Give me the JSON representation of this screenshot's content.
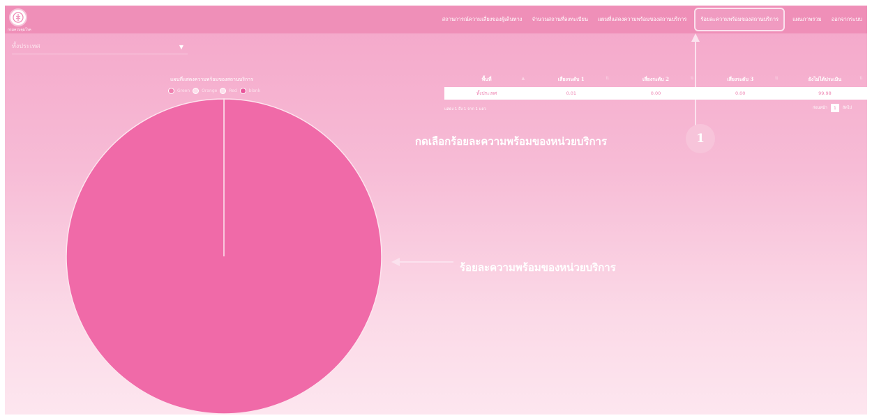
{
  "app": {
    "logo_caption": "กรมควบคุมโรค"
  },
  "nav": {
    "items": [
      {
        "label": "สถานการณ์ความเสี่ยงของผู้เดินทาง"
      },
      {
        "label": "จำนวนสถานที่ลงทะเบียน"
      },
      {
        "label": "แผนที่แสดงความพร้อมของสถานบริการ"
      },
      {
        "label": "ร้อยละความพร้อมของสถานบริการ"
      },
      {
        "label": "แผนภาพรวม"
      },
      {
        "label": "ออกจากระบบ"
      }
    ],
    "active_index": 3
  },
  "filter": {
    "selected": "ทั้งประเทศ"
  },
  "chart_data": {
    "type": "pie",
    "title": "แผนที่แสดงความพร้อมของสถานบริการ",
    "legend": [
      {
        "name": "Green",
        "color": "#f080b0",
        "hollow": false
      },
      {
        "name": "Orange",
        "color": "#fce0ec",
        "hollow": true
      },
      {
        "name": "Red",
        "color": "#fce0ec",
        "hollow": true
      },
      {
        "name": "blank",
        "color": "#e8559a",
        "hollow": false
      }
    ],
    "slices": [
      {
        "name": "Green",
        "value": 0.01
      },
      {
        "name": "Orange",
        "value": 0.0
      },
      {
        "name": "Red",
        "value": 0.0
      },
      {
        "name": "blank",
        "value": 99.98
      }
    ],
    "fill_color": "#f06aa8"
  },
  "table": {
    "headers": [
      "พื้นที่",
      "เสี่ยงระดับ 1",
      "เสี่ยงระดับ 2",
      "เสี่ยงระดับ 3",
      "ยังไม่ได้ประเมิน"
    ],
    "rows": [
      [
        "ทั้งประเทศ",
        "0.01",
        "0.00",
        "0.00",
        "99.98"
      ]
    ],
    "info": "แสดง 1 ถึง 1 จาก 1 แถว",
    "pager": {
      "prev": "ก่อนหน้า",
      "page": "1",
      "next": "ถัดไป"
    }
  },
  "annotations": {
    "step_text": "กดเลือกร้อยละความพร้อมของหน่วยบริการ",
    "step_number": "1",
    "pie_text": "ร้อยละความพร้อมของหน่วยบริการ"
  }
}
